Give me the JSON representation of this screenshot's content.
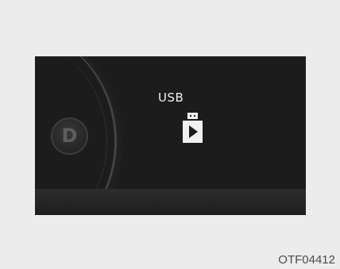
{
  "display": {
    "source_label": "USB",
    "gear_indicator": "D",
    "media_icon": "usb-play-icon"
  },
  "figure": {
    "caption": "OTF04412"
  },
  "colors": {
    "screen_background": "#1c1c1c",
    "text_primary": "#f0f0f0",
    "page_background": "#ececec"
  }
}
